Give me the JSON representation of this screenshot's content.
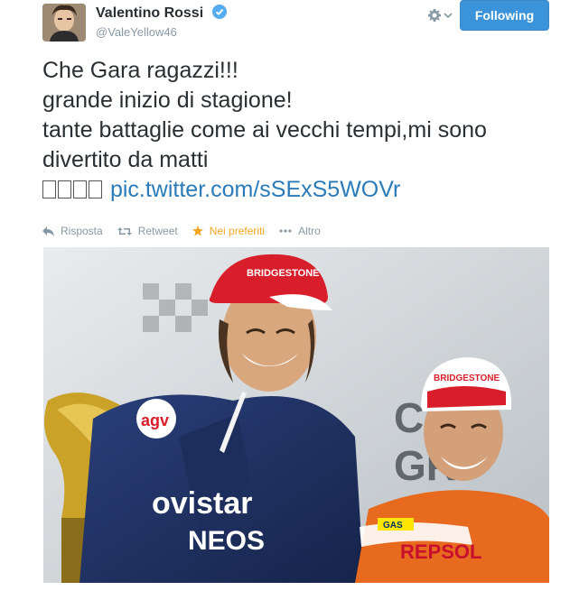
{
  "user": {
    "name": "Valentino Rossi",
    "handle": "@ValeYellow46",
    "verified": true
  },
  "follow_button": {
    "label": "Following",
    "color": "#3b94d9"
  },
  "settings": {
    "icon": "gear-icon",
    "dropdown_icon": "chevron-down-icon"
  },
  "tweet": {
    "lines": [
      "Che Gara ragazzi!!!",
      "grande inizio di stagione!",
      "tante battaglie come ai vecchi tempi,mi sono",
      "divertito da matti"
    ],
    "link": "pic.twitter.com/sSExS5WOVr"
  },
  "actions": {
    "reply": "Risposta",
    "retweet": "Retweet",
    "favorite": "Nei preferiti",
    "more": "Altro"
  },
  "photo": {
    "cap_left_brand": "BRIDGESTONE",
    "cap_right_brand": "BRIDGESTONE",
    "bg_text_line1": "C",
    "bg_text_line2": "GR",
    "bg_text_line3": "",
    "suit_text_1": "ovistar",
    "suit_text_2": "NEOS",
    "suit_text_3": "REPSOL",
    "badge_agv": "agv",
    "badge_gas": "GAS",
    "badge_eneos": "ENEOS"
  }
}
